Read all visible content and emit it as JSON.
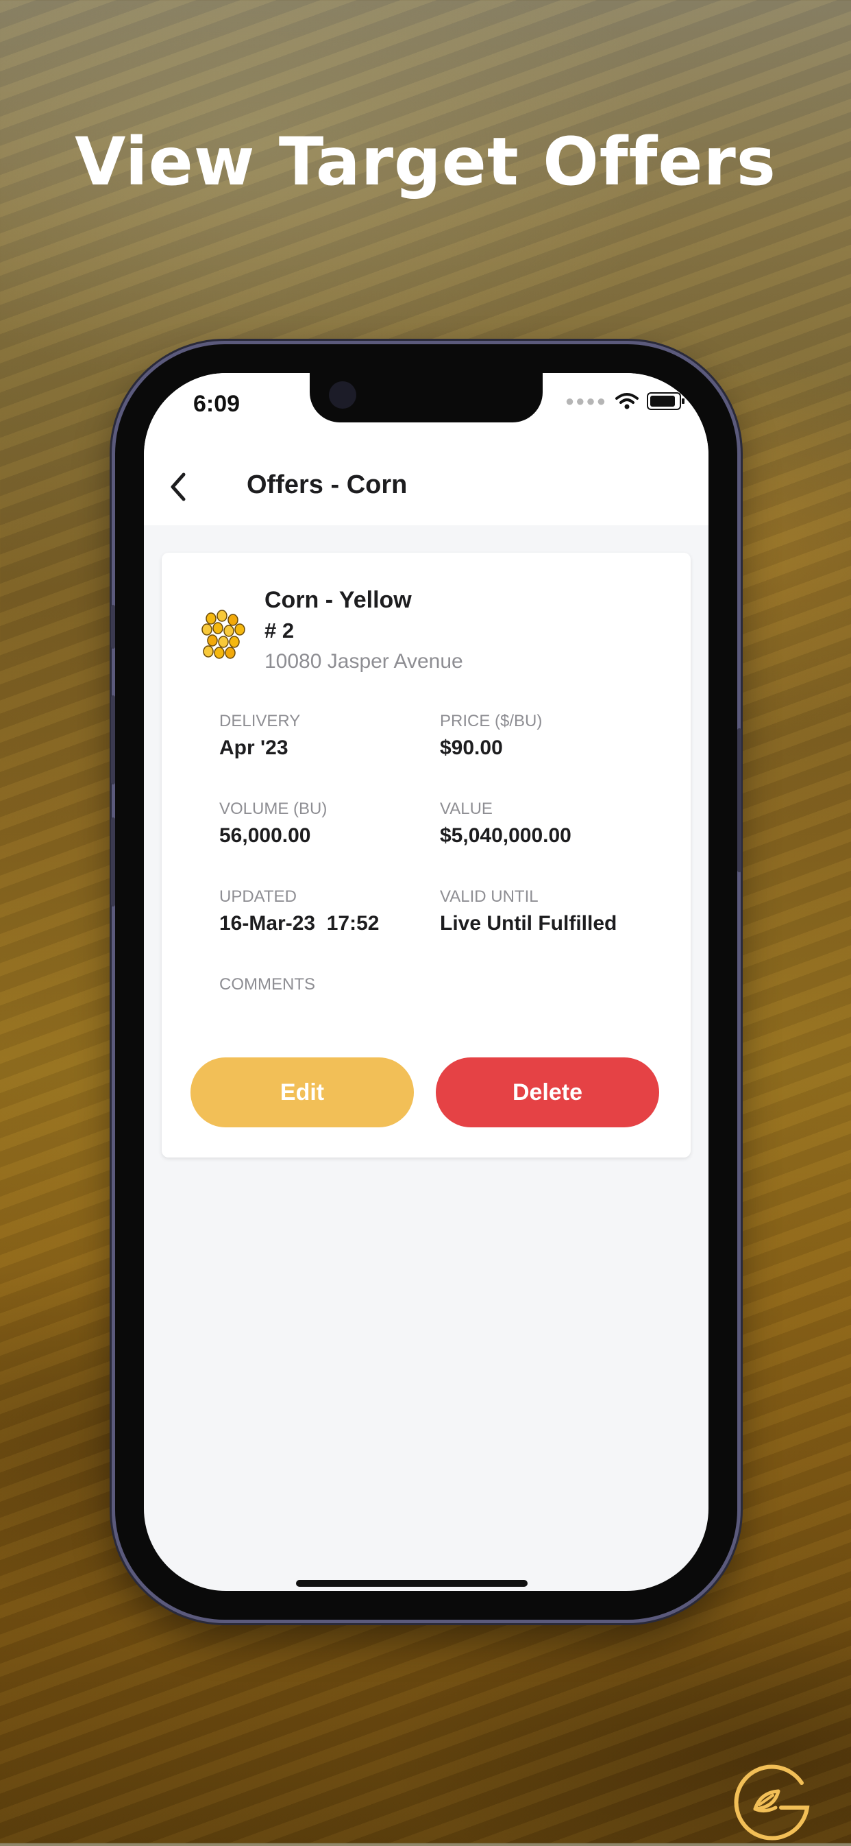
{
  "headline": "View Target Offers",
  "status_bar": {
    "time": "6:09",
    "signal_icon": "signal-dots-icon",
    "wifi_icon": "wifi-icon",
    "battery_icon": "battery-icon"
  },
  "nav": {
    "back_icon": "chevron-left-icon",
    "title": "Offers - Corn"
  },
  "offer": {
    "thumbnail_icon": "corn-kernels-icon",
    "commodity": "Corn - Yellow",
    "number": "# 2",
    "location": "10080 Jasper Avenue",
    "fields": {
      "delivery_label": "DELIVERY",
      "delivery_value": "Apr '23",
      "price_label": "PRICE ($/BU)",
      "price_value": "$90.00",
      "volume_label": "VOLUME (BU)",
      "volume_value": "56,000.00",
      "value_label": "VALUE",
      "value_value": "$5,040,000.00",
      "updated_label": "UPDATED",
      "updated_value": "16-Mar-23  17:52",
      "valid_label": "VALID UNTIL",
      "valid_value": "Live Until Fulfilled",
      "comments_label": "COMMENTS",
      "comments_value": ""
    },
    "actions": {
      "edit_label": "Edit",
      "delete_label": "Delete"
    }
  },
  "brand_logo": "leaf-g-logo-icon",
  "colors": {
    "edit": "#f2bf57",
    "delete": "#e54245",
    "logo": "#f2bf57"
  }
}
